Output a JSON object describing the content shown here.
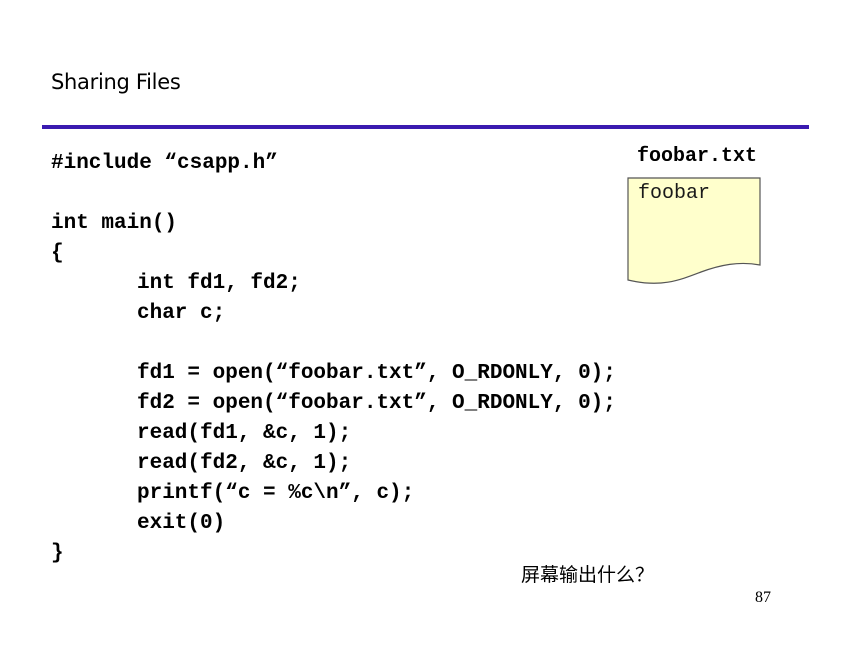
{
  "slide": {
    "title": "Sharing Files",
    "page_number": "87",
    "question": "屏幕输出什么？"
  },
  "code": {
    "lines": [
      "#include “csapp.h”",
      "",
      "int main()",
      "{",
      "int fd1, fd2;",
      "char c;",
      "",
      "fd1 = open(“foobar.txt”, O_RDONLY, 0);",
      "fd2 = open(“foobar.txt”, O_RDONLY, 0);",
      "read(fd1, &c, 1);",
      "read(fd2, &c, 1);",
      "printf(“c = %c\\n”, c);",
      "exit(0)",
      "}"
    ]
  },
  "file": {
    "name": "foobar.txt",
    "content": "foobar"
  },
  "colors": {
    "rule": "#3a1ab0",
    "document_fill": "#ffffcc",
    "document_stroke": "#555555"
  }
}
